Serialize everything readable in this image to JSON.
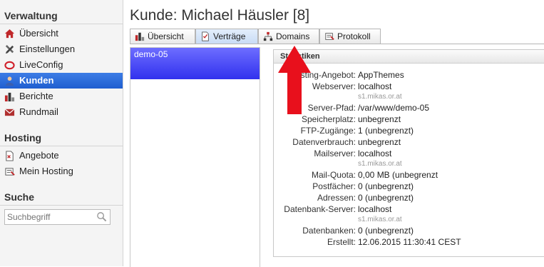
{
  "sidebar": {
    "verwaltung": {
      "title": "Verwaltung",
      "items": [
        {
          "label": "Übersicht"
        },
        {
          "label": "Einstellungen"
        },
        {
          "label": "LiveConfig"
        },
        {
          "label": "Kunden",
          "active": true
        },
        {
          "label": "Berichte"
        },
        {
          "label": "Rundmail"
        }
      ]
    },
    "hosting": {
      "title": "Hosting",
      "items": [
        {
          "label": "Angebote"
        },
        {
          "label": "Mein Hosting"
        }
      ]
    },
    "suche": {
      "title": "Suche",
      "placeholder": "Suchbegriff"
    }
  },
  "main": {
    "title": "Kunde: Michael Häusler [8]",
    "tabs": [
      {
        "label": "Übersicht"
      },
      {
        "label": "Verträge",
        "active": true
      },
      {
        "label": "Domains"
      },
      {
        "label": "Protokoll"
      }
    ],
    "contracts": [
      {
        "label": "demo-05",
        "selected": true
      }
    ],
    "stats": {
      "title": "Statistiken",
      "rows": [
        {
          "label": "Hosting-Angebot:",
          "value": "AppThemes"
        },
        {
          "label": "Webserver:",
          "value": "localhost"
        },
        {
          "label": "",
          "value": "s1.mikas.or.at",
          "sub": true
        },
        {
          "label": "Server-Pfad:",
          "value": "/var/www/demo-05"
        },
        {
          "label": "Speicherplatz:",
          "value": "unbegrenzt"
        },
        {
          "label": "FTP-Zugänge:",
          "value": "1 (unbegrenzt)"
        },
        {
          "label": "Datenverbrauch:",
          "value": "unbegrenzt"
        },
        {
          "label": "Mailserver:",
          "value": "localhost"
        },
        {
          "label": "",
          "value": "s1.mikas.or.at",
          "sub": true
        },
        {
          "label": "Mail-Quota:",
          "value": "0,00 MB (unbegrenzt"
        },
        {
          "label": "Postfächer:",
          "value": "0 (unbegrenzt)"
        },
        {
          "label": "Adressen:",
          "value": "0 (unbegrenzt)"
        },
        {
          "label": "Datenbank-Server:",
          "value": "localhost"
        },
        {
          "label": "",
          "value": "s1.mikas.or.at",
          "sub": true
        },
        {
          "label": "Datenbanken:",
          "value": "0 (unbegrenzt)"
        },
        {
          "label": "Erstellt:",
          "value": "12.06.2015 11:30:41 CEST"
        }
      ]
    }
  },
  "colors": {
    "active_nav": "#2a68d8",
    "selected_item": "#4a4af5",
    "arrow": "#e8101c"
  }
}
